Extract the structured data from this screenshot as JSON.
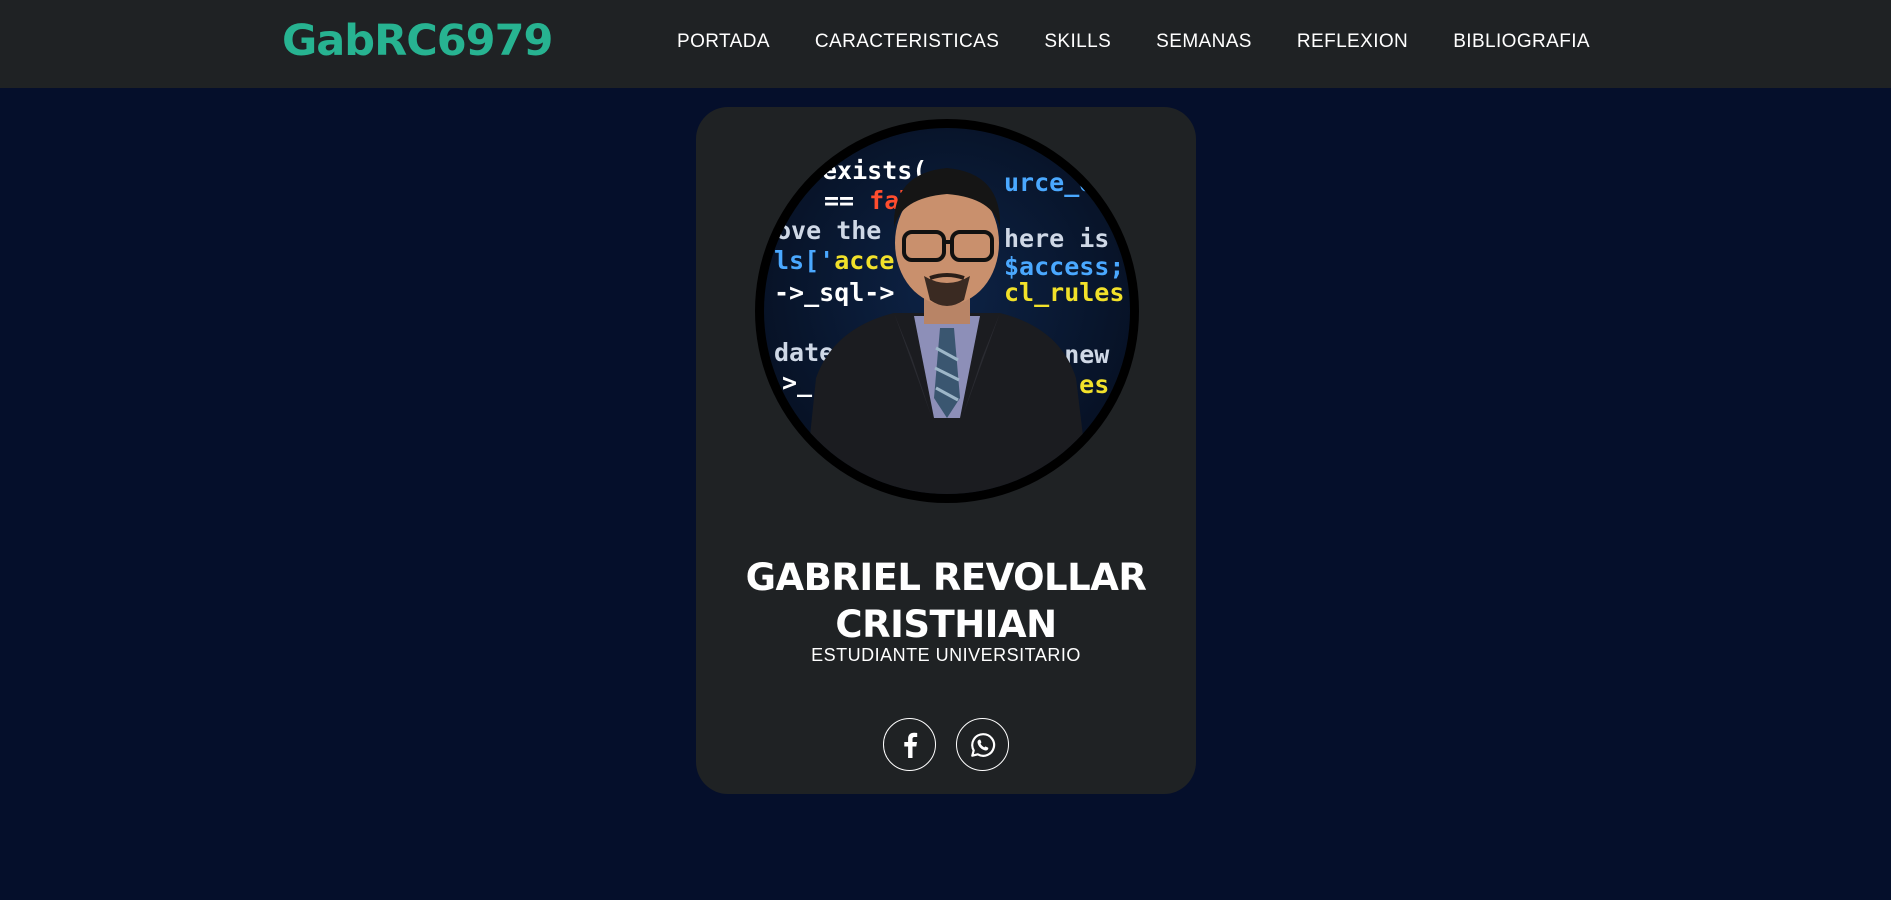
{
  "header": {
    "logo": "GabRC6979",
    "nav": [
      "PORTADA",
      "CARACTERISTICAS",
      "SKILLS",
      "SEMANAS",
      "REFLEXION",
      "BIBLIOGRAFIA"
    ]
  },
  "profile": {
    "name_line1": "GABRIEL REVOLLAR",
    "name_line2": "CRISTHIAN",
    "role": "ESTUDIANTE UNIVERSITARIO",
    "photo_icon": "profile-photo",
    "socials": [
      {
        "name": "facebook",
        "icon": "facebook-icon"
      },
      {
        "name": "whatsapp",
        "icon": "whatsapp-icon"
      }
    ]
  },
  "colors": {
    "background": "#050f2b",
    "navbar": "#1f2224",
    "card": "#1f2224",
    "accent": "#27b391",
    "text": "#ffffff"
  }
}
